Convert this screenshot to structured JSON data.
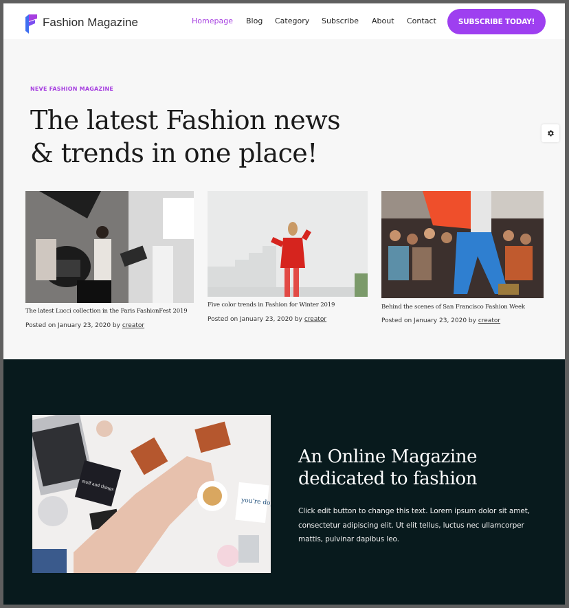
{
  "header": {
    "brand": "Fashion Magazine",
    "nav": [
      "Homepage",
      "Blog",
      "Category",
      "Subscribe",
      "About",
      "Contact"
    ],
    "active_nav": "Homepage",
    "cta": "SUBSCRIBE TODAY!"
  },
  "hero": {
    "eyebrow": "NEVE FASHION MAGAZINE",
    "title_line1": "The latest Fashion news",
    "title_line2": "& trends in one place!"
  },
  "posts": [
    {
      "title": "The latest Lucci collection in the Paris FashionFest 2019",
      "posted": "Posted on January 23, 2020 by",
      "author": "creator"
    },
    {
      "title": "Five color trends in Fashion for Winter 2019",
      "posted": "Posted on January 23, 2020 by",
      "author": "creator"
    },
    {
      "title": "Behind the scenes of San Francisco Fashion Week",
      "posted": "Posted on January 23, 2020 by",
      "author": "creator"
    }
  ],
  "feature": {
    "title_line1": "An Online Magazine",
    "title_line2": "dedicated to fashion",
    "text": "Click edit button to change this text. Lorem ipsum dolor sit amet, consectetur adipiscing elit. Ut elit tellus, luctus nec ullamcorper mattis, pulvinar dapibus leo.",
    "image_card_text_1": "you're dope.",
    "image_card_text_2": "stuff and things"
  },
  "colors": {
    "accent": "#9e3ff0",
    "dark_section": "#081a1d"
  },
  "icons": [
    "logo-f-icon",
    "gear-icon"
  ]
}
